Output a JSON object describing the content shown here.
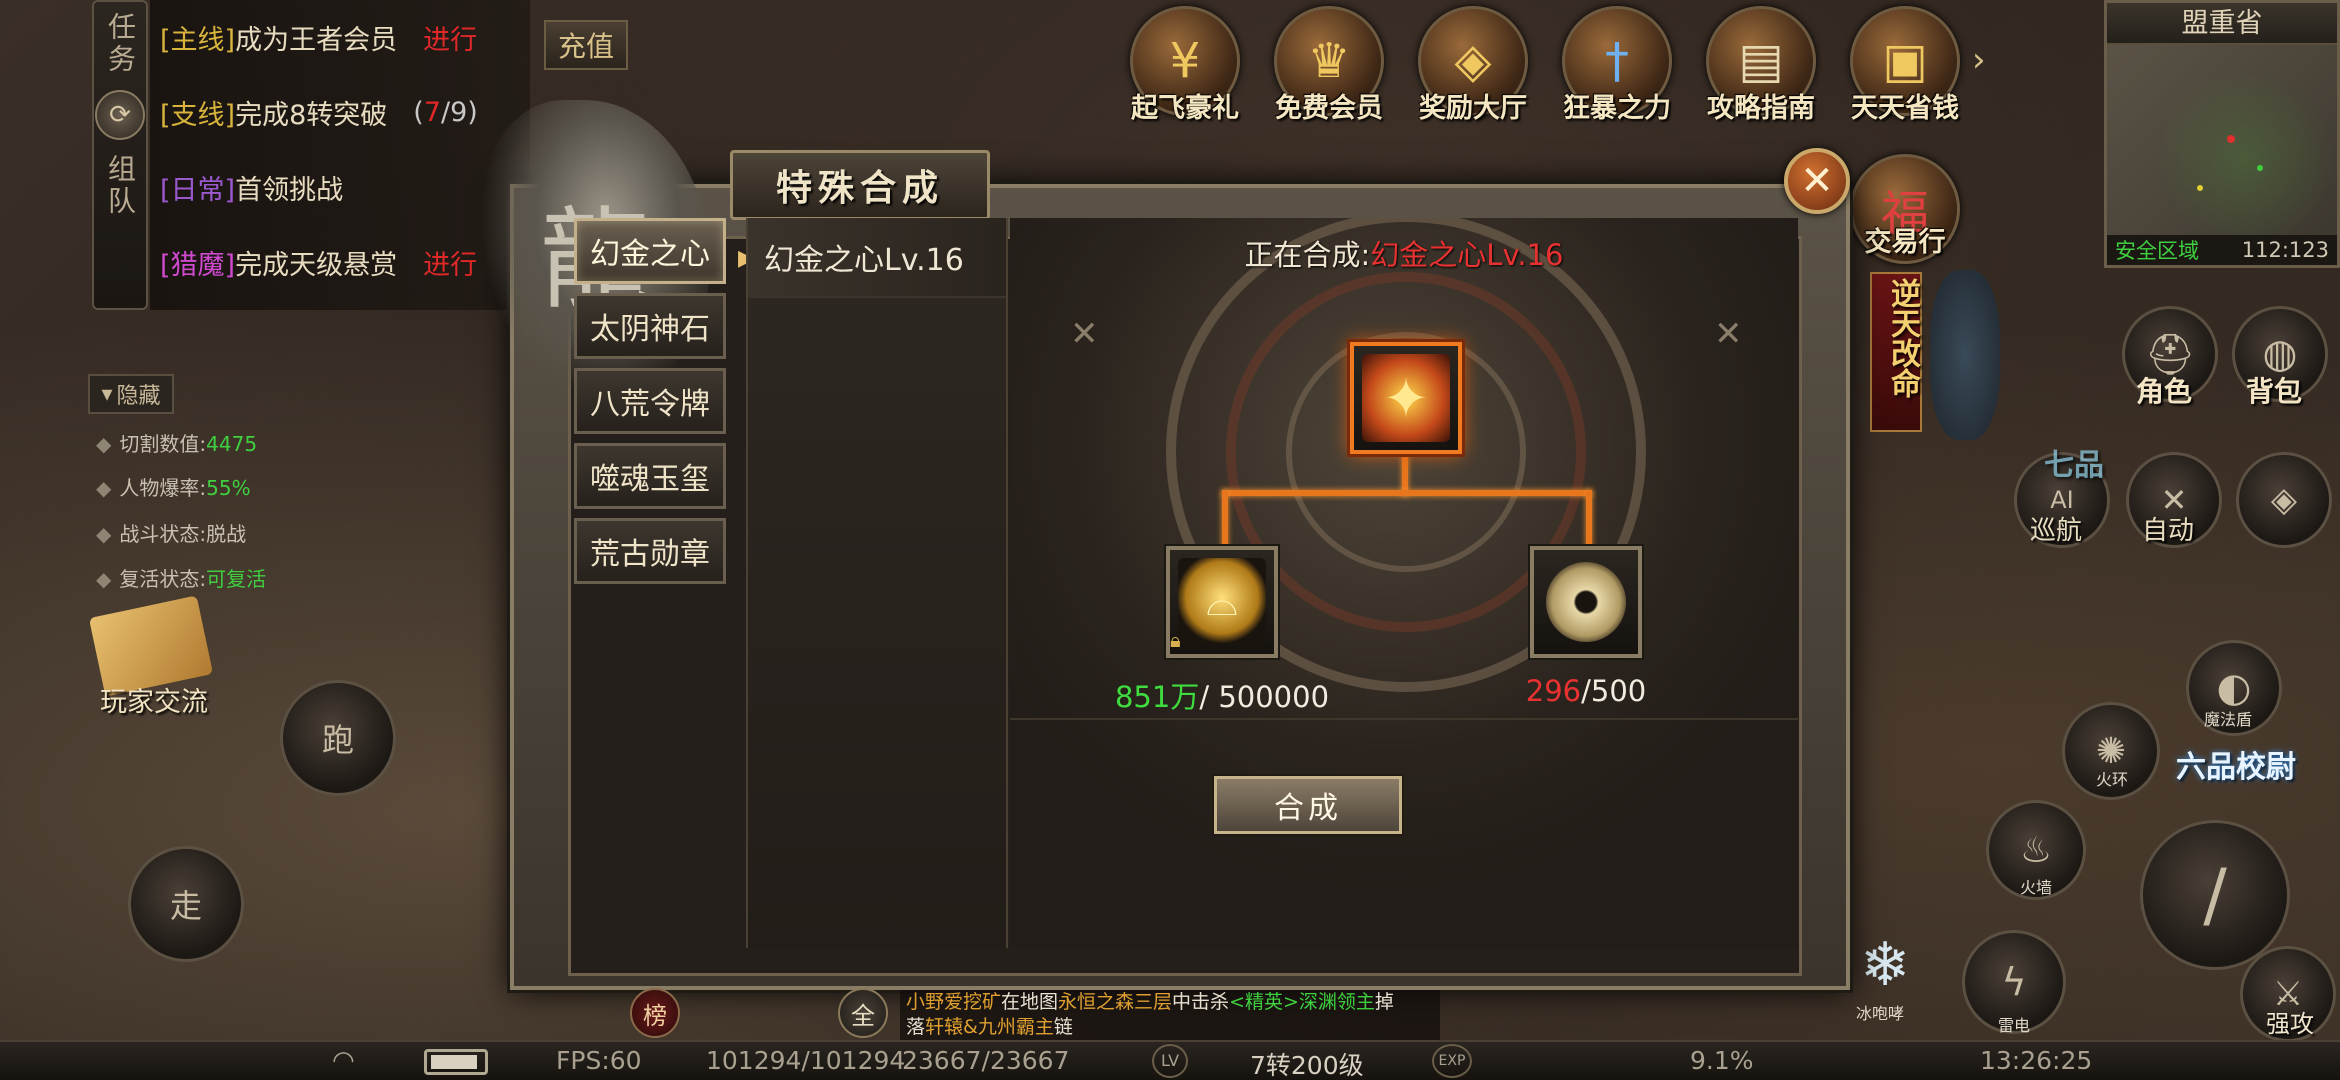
{
  "quests": {
    "tabs": [
      "任务",
      "组队"
    ],
    "rows": [
      {
        "tag": "[主线]",
        "text": "成为王者会员",
        "status": "进行"
      },
      {
        "tag": "[支线]",
        "text": "完成8转突破",
        "progress": "7",
        "progress_total": "/9"
      },
      {
        "tag": "[日常]",
        "text": "首领挑战"
      },
      {
        "tag": "[猎魔]",
        "text": "完成天级悬赏",
        "status": "进行"
      }
    ]
  },
  "recharge_label": "充值",
  "top_icons": [
    {
      "label": "起飞豪礼",
      "icon": "coin-icon"
    },
    {
      "label": "免费会员",
      "icon": "crown-icon"
    },
    {
      "label": "奖励大厅",
      "icon": "treasure-icon"
    },
    {
      "label": "狂暴之力",
      "icon": "sword-icon"
    },
    {
      "label": "攻略指南",
      "icon": "scroll-icon"
    },
    {
      "label": "天天省钱",
      "icon": "chest-icon"
    }
  ],
  "trade_label": "交易行",
  "minimap": {
    "title": "盟重省",
    "zone": "安全区域",
    "coords": "112:123"
  },
  "left_status": {
    "hide_label": "隐藏",
    "cut_label": "切割数值:",
    "cut_value": "4475",
    "drop_label": "人物爆率:",
    "drop_value": "55%",
    "battle_label": "战斗状态:",
    "battle_value": "脱战",
    "revive_label": "复活状态:",
    "revive_value": "可复活"
  },
  "player_exchange": "玩家交流",
  "run_label": "跑",
  "walk_label": "走",
  "right_side": {
    "banner_text": "逆天改命",
    "role_label": "角色",
    "bag_label": "背包",
    "auto_label": "自动",
    "patrol_label": "巡航",
    "rank_text": "六品校尉",
    "rank_text2": "七品",
    "fire_label": "火环",
    "firewall_label": "火墙",
    "thunder_label": "雷电",
    "ice_label": "冰咆哮",
    "strong_label": "强攻",
    "shield_label": "魔法盾"
  },
  "dialog": {
    "title": "特殊合成",
    "categories": [
      "幻金之心",
      "太阴神石",
      "八荒令牌",
      "噬魂玉玺",
      "荒古勋章"
    ],
    "active_category": 0,
    "items": [
      "幻金之心Lv.16"
    ],
    "crafting_prefix": "正在合成:",
    "crafting_name": "幻金之心Lv.16",
    "material1": {
      "have": "851万",
      "need": "/ 500000",
      "icon": "gold-ingot-icon"
    },
    "material2": {
      "have": "296",
      "need": "/500",
      "icon": "jade-disc-icon"
    },
    "target_icon": "golden-heart-icon",
    "craft_button": "合成"
  },
  "chat": {
    "line1_name": "小野爱挖矿",
    "line1_text": "在地图",
    "line1_map": "永恒之森三层",
    "line1_text2": "中击杀",
    "line1_boss": "<精英>深渊领主",
    "line1_end": "掉",
    "line2_text": "落",
    "line2_item": "轩辕&九州霸主",
    "line2_end": "链"
  },
  "bottom_bar": {
    "fps": "FPS:60",
    "hp": "101294/101294",
    "mp": "23667/23667",
    "lv_badge": "LV",
    "level": "7转200级",
    "exp_badge": "EXP",
    "exp": "9.1%",
    "time": "13:26:25",
    "rank_badge": "榜",
    "all_badge": "全"
  }
}
